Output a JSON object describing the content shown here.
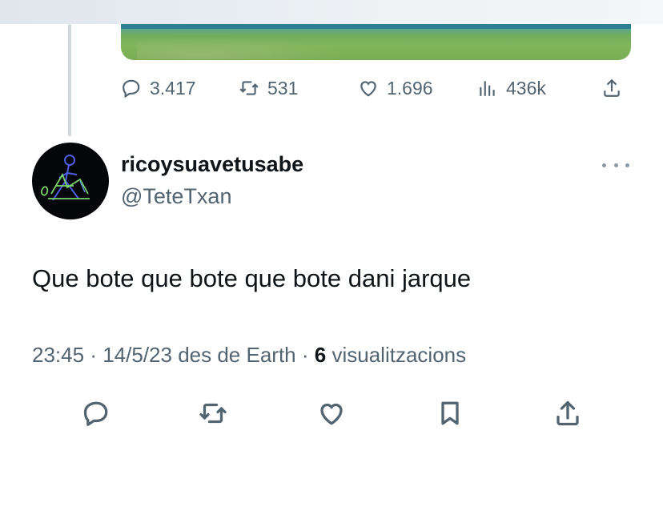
{
  "parent_tweet": {
    "stats": {
      "replies": "3.417",
      "retweets": "531",
      "likes": "1.696",
      "views": "436k"
    }
  },
  "tweet": {
    "display_name": "ricoysuavetusabe",
    "handle": "@TeteTxan",
    "text": "Que bote que bote que bote dani jarque",
    "time": "23:45",
    "date": "14/5/23",
    "source": "des de Earth",
    "views_count": "6",
    "views_label": "visualitzacions",
    "separator": "·"
  },
  "icons": {
    "reply": "reply-icon",
    "retweet": "retweet-icon",
    "like": "heart-icon",
    "views": "views-icon",
    "share": "share-icon",
    "bookmark": "bookmark-icon",
    "more": "more-icon"
  },
  "colors": {
    "text_primary": "#0f1419",
    "text_secondary": "#536471",
    "thread_line": "#cfd9de"
  }
}
